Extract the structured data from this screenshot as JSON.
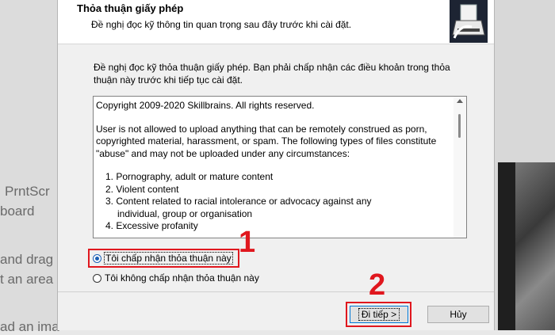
{
  "background": {
    "left_lines": [
      "PrntScr",
      "board",
      "and drag",
      "t an area",
      "ad an ima"
    ]
  },
  "header": {
    "title": "Thỏa thuận giấy phép",
    "subtitle": "Đề nghị đọc kỹ thông tin quan trọng sau đây trước khi cài đặt."
  },
  "intro": "Đề nghị đọc kỹ thỏa thuận giấy phép. Bạn phải chấp nhận các điều khoản trong thỏa thuận này trước khi tiếp tục cài đặt.",
  "license": {
    "copyright": "Copyright 2009-2020 Skillbrains. All rights reserved.",
    "p1": "User is not allowed to upload anything that can be remotely construed as porn, copyrighted material, harassment, or spam. The following types of files constitute \"abuse\" and may not be uploaded under any circumstances:",
    "items": [
      "1. Pornography, adult or mature content",
      "2. Violent content",
      "3. Content related to racial intolerance or advocacy against any",
      "individual, group or organisation",
      "4. Excessive profanity"
    ]
  },
  "options": {
    "accept": "Tôi chấp nhận thỏa thuận này",
    "decline": "Tôi không chấp nhận thỏa thuận này",
    "selected": "accept"
  },
  "buttons": {
    "next": "Đi tiếp >",
    "cancel": "Hủy"
  },
  "annotations": {
    "step1": "1",
    "step2": "2",
    "color": "#e0171e"
  }
}
